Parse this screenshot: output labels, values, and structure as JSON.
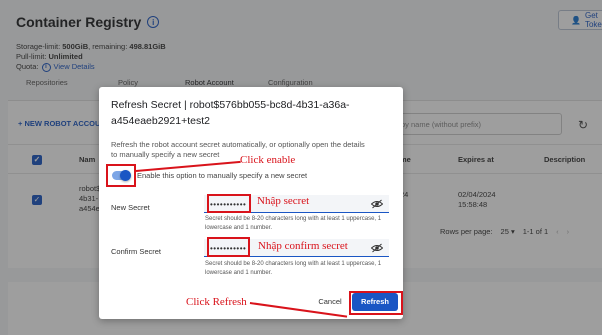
{
  "page": {
    "title": "Container Registry",
    "get_token_label": "Get Toke",
    "storage_limit_label": "Storage-limit: ",
    "storage_limit_value": "500GiB",
    "storage_remaining_label": ", remaining: ",
    "storage_remaining_value": "498.81GiB",
    "pull_limit_label": "Pull-limit: ",
    "pull_limit_value": "Unlimited",
    "quota_label": "Quota:",
    "view_details": "View Details",
    "tabs": [
      "Repositories",
      "Policy",
      "Robot Account",
      "Configuration"
    ],
    "new_robot_label": "+ NEW ROBOT ACCOU",
    "search_placeholder": "by name (without prefix)",
    "columns": {
      "name": "Nam",
      "date_partial": "me",
      "expires": "Expires at",
      "description": "Description"
    },
    "row": {
      "name_lines": [
        "robot$",
        "4b31-",
        "a454e"
      ],
      "date_partial": "24",
      "expires_date": "02/04/2024",
      "expires_time": "15:58:48"
    },
    "pagination": {
      "rows_label": "Rows per page:",
      "rows_value": "25",
      "range": "1-1 of 1"
    }
  },
  "dialog": {
    "title": "Refresh Secret | robot$576bb055-bc8d-4b31-a36a-a454eaeb2921+test2",
    "description": "Refresh the robot account secret automatically, or optionally open the details to manually specify a new secret",
    "toggle_label": "Enable this option to manually specify a new secret",
    "new_secret_label": "New Secret",
    "new_secret_value": "•••••••••••",
    "new_secret_hint": "Secret should be 8-20 characters long with at least 1 uppercase, 1 lowercase and 1 number.",
    "confirm_secret_label": "Confirm Secret",
    "confirm_secret_value": "•••••••••••",
    "confirm_secret_hint": "Secret should be 8-20 characters long with at least 1 uppercase, 1 lowercase and 1 number.",
    "cancel_label": "Cancel",
    "refresh_label": "Refresh",
    "toggle_enabled": true
  },
  "annotations": {
    "click_enable": "Click enable",
    "nhap_secret": "Nhập secret",
    "nhap_confirm": "Nhập confirm secret",
    "click_refresh": "Click Refresh"
  },
  "colors": {
    "accent": "#1a56c4",
    "annotation": "#d9131b"
  }
}
